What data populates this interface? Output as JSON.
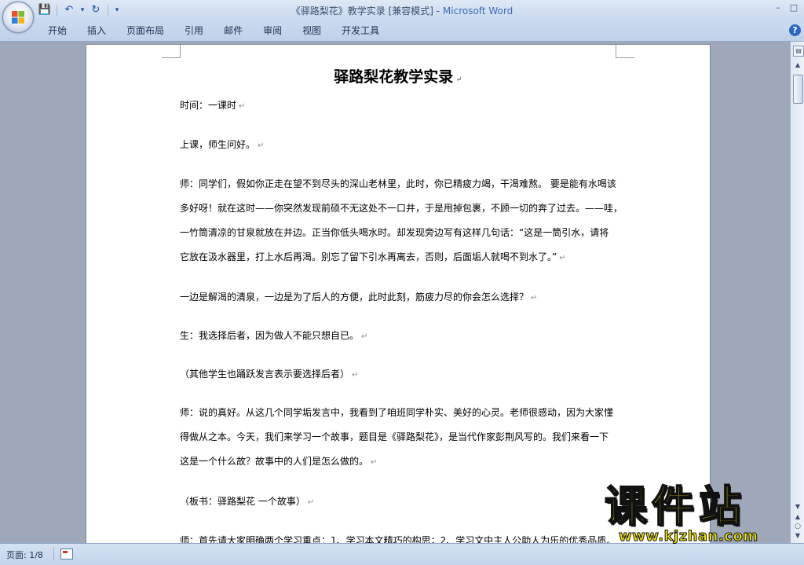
{
  "window": {
    "title_doc": "《驿路梨花》教学实录 [兼容模式] - ",
    "title_app": "Microsoft Word",
    "controls": [
      "–",
      "□"
    ]
  },
  "quick_access": {
    "save_icon": "💾",
    "undo_icon": "↶",
    "dropdown": "▾",
    "redo_icon": "↻",
    "customize": "▾"
  },
  "ribbon": {
    "tabs": [
      "开始",
      "插入",
      "页面布局",
      "引用",
      "邮件",
      "审阅",
      "视图",
      "开发工具"
    ],
    "help": "?"
  },
  "document": {
    "title": "驿路梨花教学实录",
    "paragraph_mark": "↵",
    "paragraphs": [
      [
        "时间：一课时"
      ],
      [
        "上课，师生问好。"
      ],
      [
        "师：同学们，假如你正走在望不到尽头的深山老林里，此时，你已精疲力竭，干渴难熬。 要是能有水喝该",
        "多好呀！就在这时——你突然发现前硕不无这处不一口井，于是甩掉包裹，不顾一切的奔了过去。——哇，",
        "一竹筒清凉的甘泉就放在井边。正当你低头喝水时。却发现旁边写有这样几句话：“这是一筒引水，请将",
        "它放在汲水器里，打上水后再渴。别忘了留下引水再离去，否则，后面垢人就喝不到水了。”"
      ],
      [
        "一边是解渴的清泉，一边是为了后人的方便，此时此刻，筋疲力尽的你会怎么选择？"
      ],
      [
        "生：我选择后者，因为做人不能只想自已。"
      ],
      [
        "（其他学生也踊跃发言表示要选择后者）"
      ],
      [
        "师：说的真好。从这几个同学垢发言中，我看到了咱班同学朴实、美好的心灵。老师很感动，因为大家懂",
        "得做从之本。今天，我们来学习一个故事，题目是《驿路梨花》，是当代作家彭荆风写的。我们来看一下",
        "这是一个什么故？故事中的人们是怎么做的。"
      ],
      [
        "（板书：驿路梨花 一个故事）"
      ],
      [
        "师：首先请大家明确两个学习重点：1、学习本文精巧的构思；2、学习文中主人公助人为乐的优秀品质。"
      ]
    ]
  },
  "scrollbar": {
    "ruler": "▤",
    "up": "▲",
    "down": "▼",
    "prev": "▲",
    "browse": "○",
    "next": "▼"
  },
  "status": {
    "page": "页面: 1/8"
  },
  "watermark": {
    "text": "课件站",
    "url": "www.kjzhan.com"
  }
}
